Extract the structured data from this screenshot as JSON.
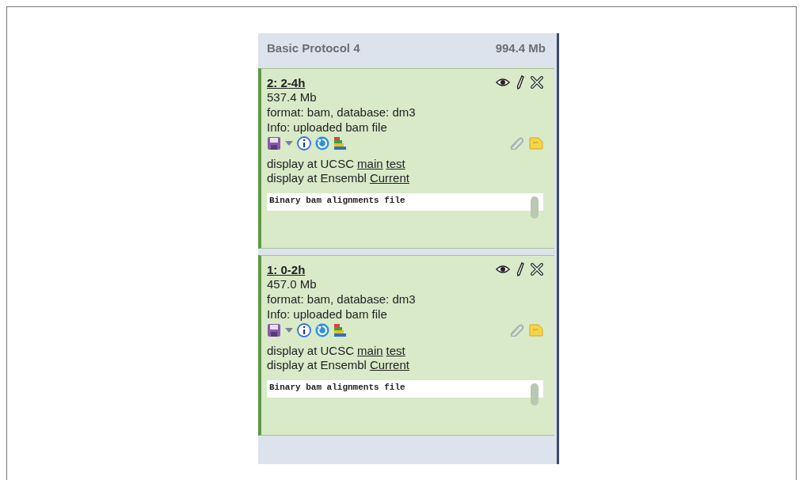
{
  "history": {
    "name": "Basic Protocol 4",
    "size": "994.4 Mb"
  },
  "datasets": [
    {
      "title": "2: 2-4h",
      "size": "537.4 Mb",
      "format_line": "format: bam, database: dm3",
      "info": "Info: uploaded bam file",
      "displays": [
        {
          "label": "display at UCSC",
          "links": [
            "main",
            "test"
          ]
        },
        {
          "label": "display at Ensembl",
          "links": [
            "Current"
          ]
        }
      ],
      "peek": "Binary bam alignments file"
    },
    {
      "title": "1: 0-2h",
      "size": "457.0 Mb",
      "format_line": "format: bam, database: dm3",
      "info": "Info: uploaded bam file",
      "displays": [
        {
          "label": "display at UCSC",
          "links": [
            "main",
            "test"
          ]
        },
        {
          "label": "display at Ensembl",
          "links": [
            "Current"
          ]
        }
      ],
      "peek": "Binary bam alignments file"
    }
  ]
}
